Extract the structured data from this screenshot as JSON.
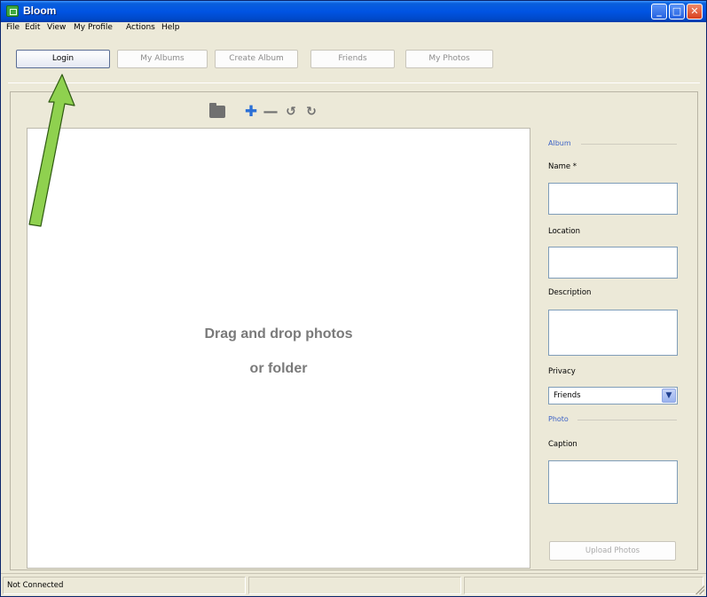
{
  "window": {
    "title": "Bloom",
    "controls": {
      "minimize": "minimize-icon",
      "maximize": "maximize-icon",
      "close": "close-icon"
    }
  },
  "menu": {
    "items": [
      {
        "label": "File",
        "mnemonic": "F"
      },
      {
        "label": "Edit",
        "mnemonic": "E"
      },
      {
        "label": "View",
        "mnemonic": "V"
      },
      {
        "label": "My Profile",
        "mnemonic": "M"
      },
      {
        "label": "Actions",
        "mnemonic": "A"
      },
      {
        "label": "Help",
        "mnemonic": "H"
      }
    ]
  },
  "nav": {
    "login": "Login",
    "my_albums": "My Albums",
    "create_album": "Create Album",
    "friends": "Friends",
    "my_photos": "My Photos"
  },
  "toolbar": {
    "icons": [
      "folder-icon",
      "add-icon",
      "remove-icon",
      "rotate-left-icon",
      "rotate-right-icon"
    ]
  },
  "drop_area": {
    "line1": "Drag and drop photos",
    "line2": "or folder"
  },
  "form": {
    "album_section": "Album",
    "name_label": "Name *",
    "name_value": "",
    "location_label": "Location",
    "location_value": "",
    "description_label": "Description",
    "description_value": "",
    "privacy_label": "Privacy",
    "privacy_value": "Friends",
    "photo_section": "Photo",
    "caption_label": "Caption",
    "caption_value": "",
    "upload_button": "Upload Photos"
  },
  "status": {
    "connection": "Not Connected"
  },
  "colors": {
    "titlebar": "#0054e3",
    "section_label": "#3d63c6",
    "annotation_arrow": "#8fd14f"
  }
}
